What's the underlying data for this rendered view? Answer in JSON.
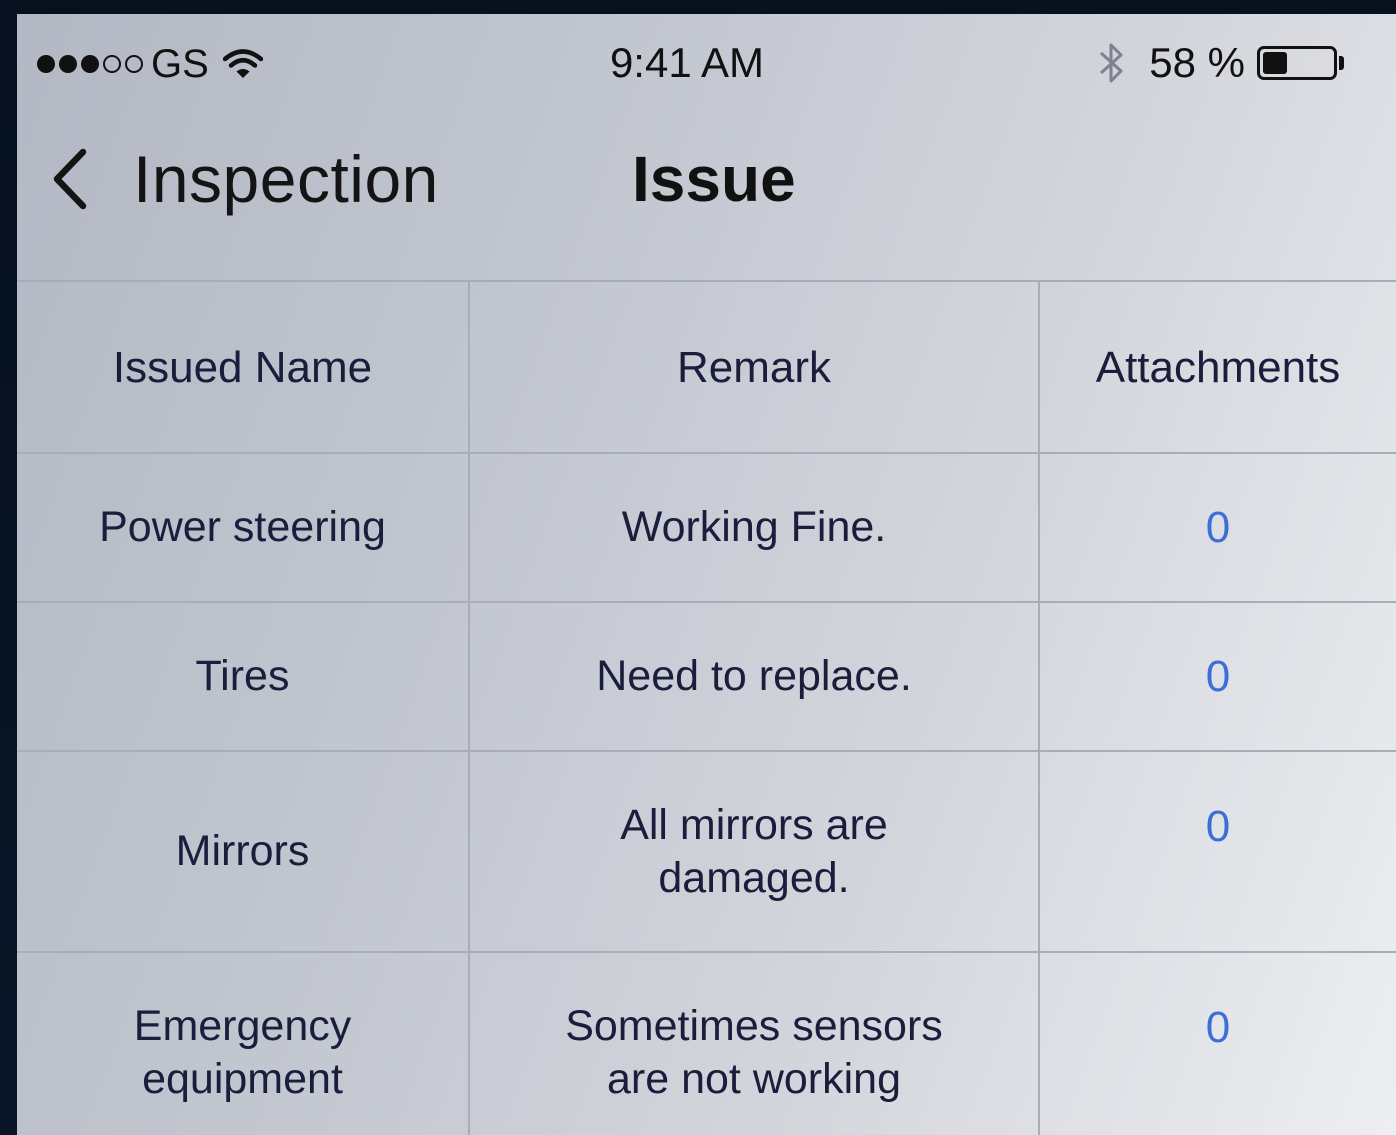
{
  "status_bar": {
    "carrier": "GS",
    "signal_bars_filled": 3,
    "signal_bars_total": 5,
    "time": "9:41 AM",
    "battery_text": "58 %",
    "battery_level": 0.58
  },
  "nav": {
    "back_label": "Inspection",
    "title": "Issue"
  },
  "table": {
    "headers": [
      "Issued Name",
      "Remark",
      "Attachments"
    ],
    "rows": [
      {
        "name": "Power steering",
        "remark": "Working Fine.",
        "attachments": "0"
      },
      {
        "name": "Tires",
        "remark": "Need to replace.",
        "attachments": "0"
      },
      {
        "name": "Mirrors",
        "remark": "All mirrors are damaged.",
        "attachments": "0"
      },
      {
        "name": "Emergency equipment",
        "remark": "Sometimes sensors are not working",
        "attachments": "0"
      }
    ]
  },
  "colors": {
    "attachment_link": "#3b6fd6",
    "table_text": "#1b1d3c",
    "divider": "#a9adb7"
  },
  "icons": [
    "wifi-icon",
    "bluetooth-icon",
    "battery-icon",
    "back-chevron-icon"
  ]
}
